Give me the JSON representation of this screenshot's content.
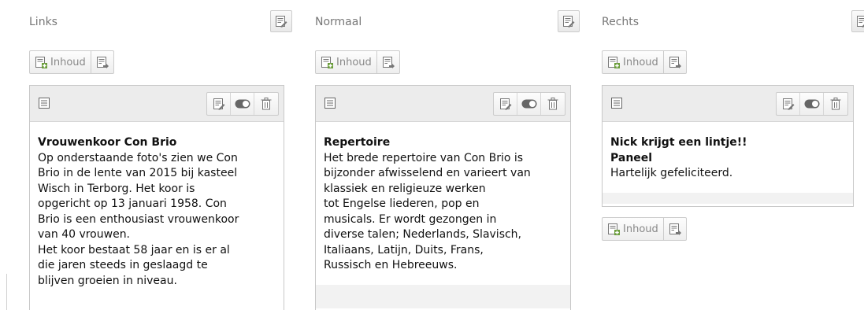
{
  "columns": [
    {
      "title": "Links",
      "new_label": "Inhoud",
      "element": {
        "heading": "Vrouwenkoor Con Brio",
        "lines": [
          "Op onderstaande foto's zien we Con",
          "Brio in de lente van 2015 bij kasteel",
          "Wisch in Terborg. Het koor  is",
          "opgericht  op 13 januari 1958. Con",
          "Brio is een enthousiast vrouwenkoor",
          "van 40 vrouwen.",
          "Het koor bestaat 58 jaar en is er al",
          "die jaren steeds in geslaagd te",
          "blijven groeien in niveau."
        ]
      }
    },
    {
      "title": "Normaal",
      "new_label": "Inhoud",
      "element": {
        "heading": "Repertoire",
        "lines": [
          "Het brede repertoire van Con Brio is",
          "bijzonder afwisselend en varieert van",
          "klassiek en religieuze werken",
          "tot Engelse liederen, pop en",
          "musicals. Er wordt gezongen in",
          "diverse talen; Nederlands,  Slavisch,",
          "Italiaans, Latijn, Duits, Frans,",
          "Russisch en Hebreeuws."
        ]
      }
    },
    {
      "title": "Rechts",
      "new_label": "Inhoud",
      "new_label_bottom": "Inhoud",
      "element": {
        "heading": "Nick krijgt een lintje!!",
        "subheading": "Paneel",
        "lines": [
          "Hartelijk gefeliciteerd."
        ]
      }
    }
  ],
  "icons": {
    "edit": "edit-page-icon",
    "new": "new-content-icon",
    "paste": "paste-icon",
    "toggle": "toggle-visibility-icon",
    "delete": "trash-icon",
    "type": "text-element-icon"
  }
}
